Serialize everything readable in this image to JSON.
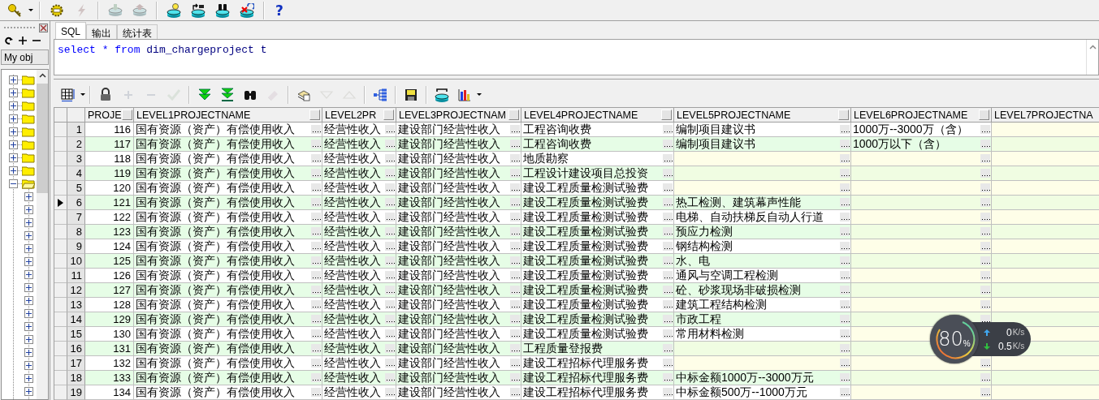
{
  "toolbar": [
    {
      "kind": "key",
      "disabled": false
    },
    {
      "kind": "caret",
      "disabled": false
    },
    {
      "kind": "separator"
    },
    {
      "kind": "gear",
      "disabled": false
    },
    {
      "kind": "bolt",
      "disabled": true
    },
    {
      "kind": "separator"
    },
    {
      "kind": "download",
      "disabled": true
    },
    {
      "kind": "upload",
      "disabled": true
    },
    {
      "kind": "separator"
    },
    {
      "kind": "db-bulb",
      "disabled": false
    },
    {
      "kind": "db-arrow",
      "disabled": false
    },
    {
      "kind": "db-binoculars",
      "disabled": false
    },
    {
      "kind": "db-cross",
      "disabled": false
    },
    {
      "kind": "separator"
    },
    {
      "kind": "help",
      "label": "?",
      "disabled": false
    }
  ],
  "object_browser": {
    "filter": "My obj",
    "tree": [
      {
        "expanded": false
      },
      {
        "expanded": false
      },
      {
        "expanded": false
      },
      {
        "expanded": false
      },
      {
        "expanded": false
      },
      {
        "expanded": false
      },
      {
        "expanded": false
      },
      {
        "expanded": false
      },
      {
        "expanded": true,
        "children": [
          {
            "expanded": false
          },
          {
            "expanded": false
          },
          {
            "expanded": false
          },
          {
            "expanded": false
          },
          {
            "expanded": false
          },
          {
            "expanded": false
          },
          {
            "expanded": false
          },
          {
            "expanded": false
          },
          {
            "expanded": false
          },
          {
            "expanded": false
          },
          {
            "expanded": false
          },
          {
            "expanded": false
          },
          {
            "expanded": false
          },
          {
            "expanded": false
          },
          {
            "expanded": false
          },
          {
            "expanded": false
          }
        ]
      }
    ]
  },
  "tabs": [
    {
      "label": "SQL",
      "selected": true
    },
    {
      "label": "输出",
      "selected": false
    },
    {
      "label": "统计表",
      "selected": false
    }
  ],
  "sql_editor": {
    "tokens": [
      {
        "text": "select",
        "kind": "keyword"
      },
      {
        "text": "*",
        "kind": "keyword"
      },
      {
        "text": "from",
        "kind": "keyword"
      },
      {
        "text": "dim_chargeproject",
        "kind": "identifier"
      },
      {
        "text": "t",
        "kind": "identifier"
      }
    ]
  },
  "grid_toolbar": [
    {
      "kind": "grid",
      "disabled": false
    },
    {
      "kind": "caret",
      "disabled": false
    },
    {
      "kind": "separator"
    },
    {
      "kind": "lock",
      "disabled": false
    },
    {
      "kind": "plus",
      "disabled": true
    },
    {
      "kind": "minus",
      "disabled": true
    },
    {
      "kind": "check",
      "disabled": true
    },
    {
      "kind": "separator"
    },
    {
      "kind": "double-down",
      "disabled": false
    },
    {
      "kind": "down-bar",
      "disabled": false
    },
    {
      "kind": "binoculars",
      "disabled": false
    },
    {
      "kind": "eraser",
      "disabled": true
    },
    {
      "kind": "separator"
    },
    {
      "kind": "stack",
      "disabled": false
    },
    {
      "kind": "triangle-down",
      "disabled": true
    },
    {
      "kind": "triangle-up",
      "disabled": true
    },
    {
      "kind": "separator"
    },
    {
      "kind": "tree",
      "disabled": false
    },
    {
      "kind": "separator"
    },
    {
      "kind": "floppy",
      "disabled": false
    },
    {
      "kind": "separator"
    },
    {
      "kind": "db-refresh",
      "disabled": false
    },
    {
      "kind": "bar-chart",
      "disabled": false
    },
    {
      "kind": "caret",
      "disabled": false
    }
  ],
  "table": {
    "columns": [
      "PROJE",
      "LEVEL1PROJECTNAME",
      "LEVEL2PR",
      "LEVEL3PROJECTNAM",
      "LEVEL4PROJECTNAME",
      "LEVEL5PROJECTNAME",
      "LEVEL6PROJECTNAME",
      "LEVEL7PROJECTNA"
    ],
    "rows": [
      {
        "number": "1",
        "current": false,
        "cells": [
          "116",
          "国有资源（资产）有偿使用收入",
          "经营性收入",
          "建设部门经营性收入",
          "工程咨询收费",
          "编制项目建议书",
          "1000万--3000万（含）",
          null
        ]
      },
      {
        "number": "2",
        "current": false,
        "cells": [
          "117",
          "国有资源（资产）有偿使用收入",
          "经营性收入",
          "建设部门经营性收入",
          "工程咨询收费",
          "编制项目建议书",
          "1000万以下（含）",
          null
        ]
      },
      {
        "number": "3",
        "current": false,
        "cells": [
          "118",
          "国有资源（资产）有偿使用收入",
          "经营性收入",
          "建设部门经营性收入",
          "地质勘察",
          null,
          null,
          null
        ]
      },
      {
        "number": "4",
        "current": false,
        "cells": [
          "119",
          "国有资源（资产）有偿使用收入",
          "经营性收入",
          "建设部门经营性收入",
          "工程设计建设项目总投资",
          null,
          null,
          null
        ]
      },
      {
        "number": "5",
        "current": false,
        "cells": [
          "120",
          "国有资源（资产）有偿使用收入",
          "经营性收入",
          "建设部门经营性收入",
          "建设工程质量检测试验费",
          null,
          null,
          null
        ]
      },
      {
        "number": "6",
        "current": true,
        "cells": [
          "121",
          "国有资源（资产）有偿使用收入",
          "经营性收入",
          "建设部门经营性收入",
          "建设工程质量检测试验费",
          "热工检测、建筑幕声性能",
          null,
          null
        ]
      },
      {
        "number": "7",
        "current": false,
        "cells": [
          "122",
          "国有资源（资产）有偿使用收入",
          "经营性收入",
          "建设部门经营性收入",
          "建设工程质量检测试验费",
          "电梯、自动扶梯反自动人行道",
          null,
          null
        ]
      },
      {
        "number": "8",
        "current": false,
        "cells": [
          "123",
          "国有资源（资产）有偿使用收入",
          "经营性收入",
          "建设部门经营性收入",
          "建设工程质量检测试验费",
          "预应力检测",
          null,
          null
        ]
      },
      {
        "number": "9",
        "current": false,
        "cells": [
          "124",
          "国有资源（资产）有偿使用收入",
          "经营性收入",
          "建设部门经营性收入",
          "建设工程质量检测试验费",
          "钢结构检测",
          null,
          null
        ]
      },
      {
        "number": "10",
        "current": false,
        "cells": [
          "125",
          "国有资源（资产）有偿使用收入",
          "经营性收入",
          "建设部门经营性收入",
          "建设工程质量检测试验费",
          "水、电",
          null,
          null
        ]
      },
      {
        "number": "11",
        "current": false,
        "cells": [
          "126",
          "国有资源（资产）有偿使用收入",
          "经营性收入",
          "建设部门经营性收入",
          "建设工程质量检测试验费",
          "通风与空调工程检测",
          null,
          null
        ]
      },
      {
        "number": "12",
        "current": false,
        "cells": [
          "127",
          "国有资源（资产）有偿使用收入",
          "经营性收入",
          "建设部门经营性收入",
          "建设工程质量检测试验费",
          "砼、砂浆现场非破损检测",
          null,
          null
        ]
      },
      {
        "number": "13",
        "current": false,
        "cells": [
          "128",
          "国有资源（资产）有偿使用收入",
          "经营性收入",
          "建设部门经营性收入",
          "建设工程质量检测试验费",
          "建筑工程结构检测",
          null,
          null
        ]
      },
      {
        "number": "14",
        "current": false,
        "cells": [
          "129",
          "国有资源（资产）有偿使用收入",
          "经营性收入",
          "建设部门经营性收入",
          "建设工程质量检测试验费",
          "市政工程",
          null,
          null
        ]
      },
      {
        "number": "15",
        "current": false,
        "cells": [
          "130",
          "国有资源（资产）有偿使用收入",
          "经营性收入",
          "建设部门经营性收入",
          "建设工程质量检测试验费",
          "常用材料检测",
          null,
          null
        ]
      },
      {
        "number": "16",
        "current": false,
        "cells": [
          "131",
          "国有资源（资产）有偿使用收入",
          "经营性收入",
          "建设部门经营性收入",
          "工程质量登报费",
          null,
          null,
          null
        ]
      },
      {
        "number": "17",
        "current": false,
        "cells": [
          "132",
          "国有资源（资产）有偿使用收入",
          "经营性收入",
          "建设部门经营性收入",
          "建设工程招标代理服务费",
          null,
          null,
          null
        ]
      },
      {
        "number": "18",
        "current": false,
        "cells": [
          "133",
          "国有资源（资产）有偿使用收入",
          "经营性收入",
          "建设部门经营性收入",
          "建设工程招标代理服务费",
          "中标金额1000万--3000万元",
          null,
          null
        ]
      },
      {
        "number": "19",
        "current": false,
        "cells": [
          "134",
          "国有资源（资产）有偿使用收入",
          "经营性收入",
          "建设部门经营性收入",
          "建设工程招标代理服务费",
          "中标金额500万--1000万元",
          null,
          null
        ]
      }
    ]
  },
  "network_monitor": {
    "percent": "80",
    "percent_unit": "%",
    "upload": {
      "value": "0",
      "unit": "K/s"
    },
    "download": {
      "value": "0.5",
      "unit": "K/s"
    }
  }
}
